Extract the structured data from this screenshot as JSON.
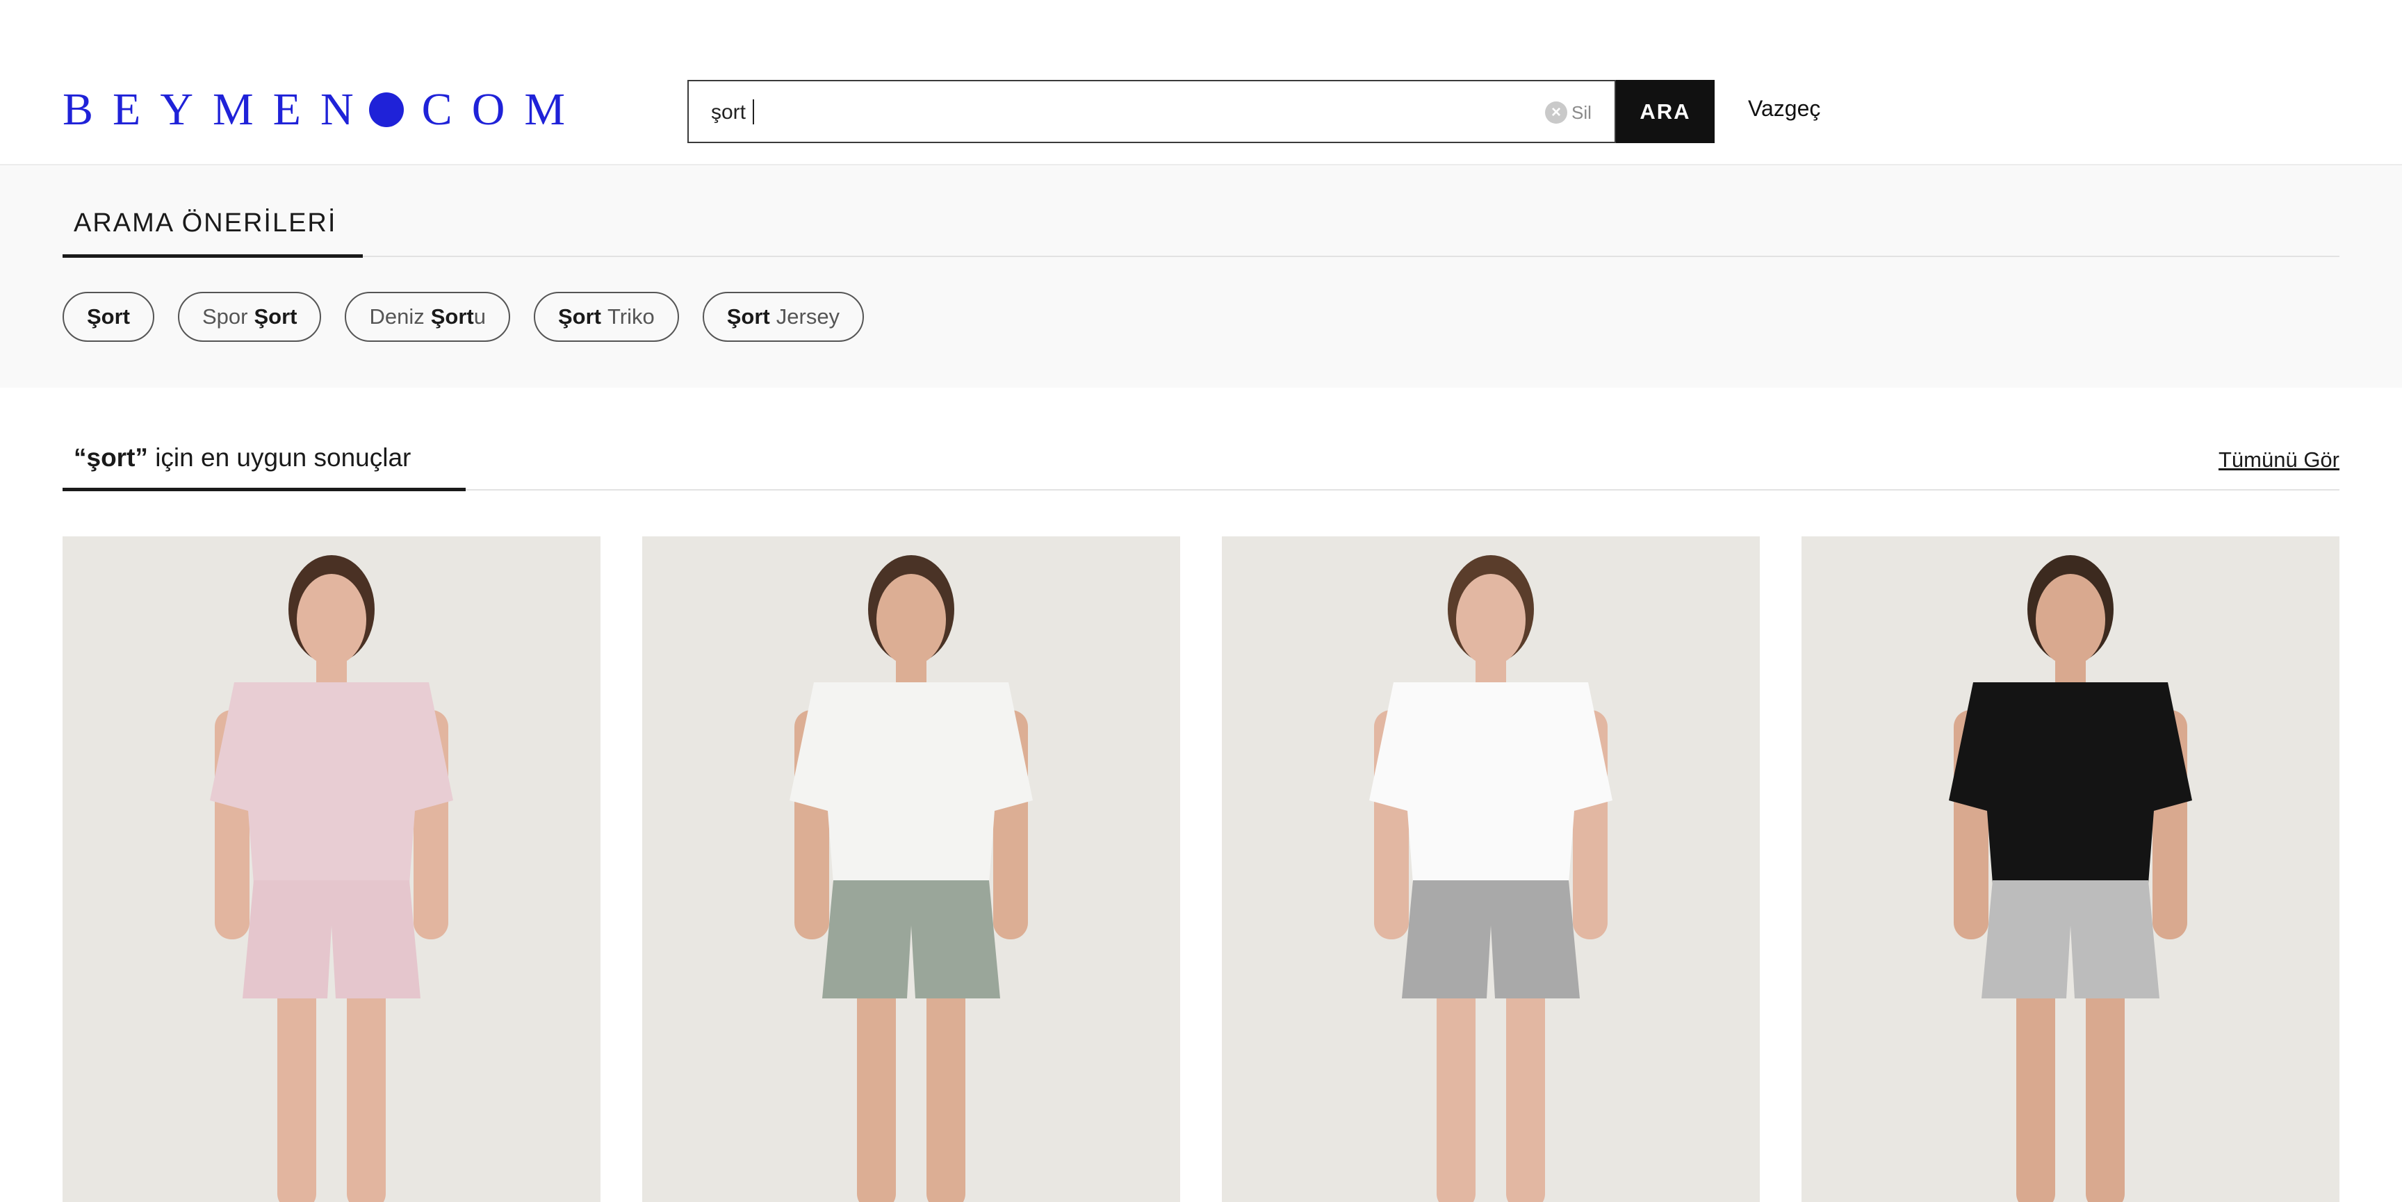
{
  "header": {
    "logo_text_left": "BEYMEN",
    "logo_text_right": "COM",
    "search": {
      "value": "şort",
      "placeholder": ""
    },
    "clear_label": "Sil",
    "search_button": "ARA",
    "cancel_label": "Vazgeç"
  },
  "suggestions": {
    "title": "ARAMA ÖNERİLERİ",
    "chips": [
      {
        "plain_before": "",
        "bold": "Şort",
        "plain_after": ""
      },
      {
        "plain_before": "Spor",
        "bold": "Şort",
        "plain_after": ""
      },
      {
        "plain_before": "Deniz",
        "bold": "Şort",
        "plain_after": "u"
      },
      {
        "plain_before": "",
        "bold": "Şort",
        "plain_after": "Triko"
      },
      {
        "plain_before": "",
        "bold": "Şort",
        "plain_after": "Jersey"
      }
    ]
  },
  "results": {
    "query_quoted": "“şort”",
    "title_rest": "için en uygun sonuçlar",
    "see_all": "Tümünü Gör"
  },
  "products": [
    {
      "top_color": "#e8cdd3",
      "bottom_color": "#e5c6cd",
      "skin": "#e2b59f",
      "hair": "#4a3124"
    },
    {
      "top_color": "#f4f4f2",
      "bottom_color": "#9aa69a",
      "skin": "#dcae94",
      "hair": "#4a3326"
    },
    {
      "top_color": "#fafafa",
      "bottom_color": "#a9a9a9",
      "skin": "#e2b7a2",
      "hair": "#5a3d2b"
    },
    {
      "top_color": "#141414",
      "bottom_color": "#bcbcbc",
      "skin": "#d9a98f",
      "hair": "#3c2a1f"
    }
  ],
  "colors": {
    "brand": "#1f22d8",
    "button_bg": "#111111",
    "suggestions_bg": "#f9f9f9"
  }
}
